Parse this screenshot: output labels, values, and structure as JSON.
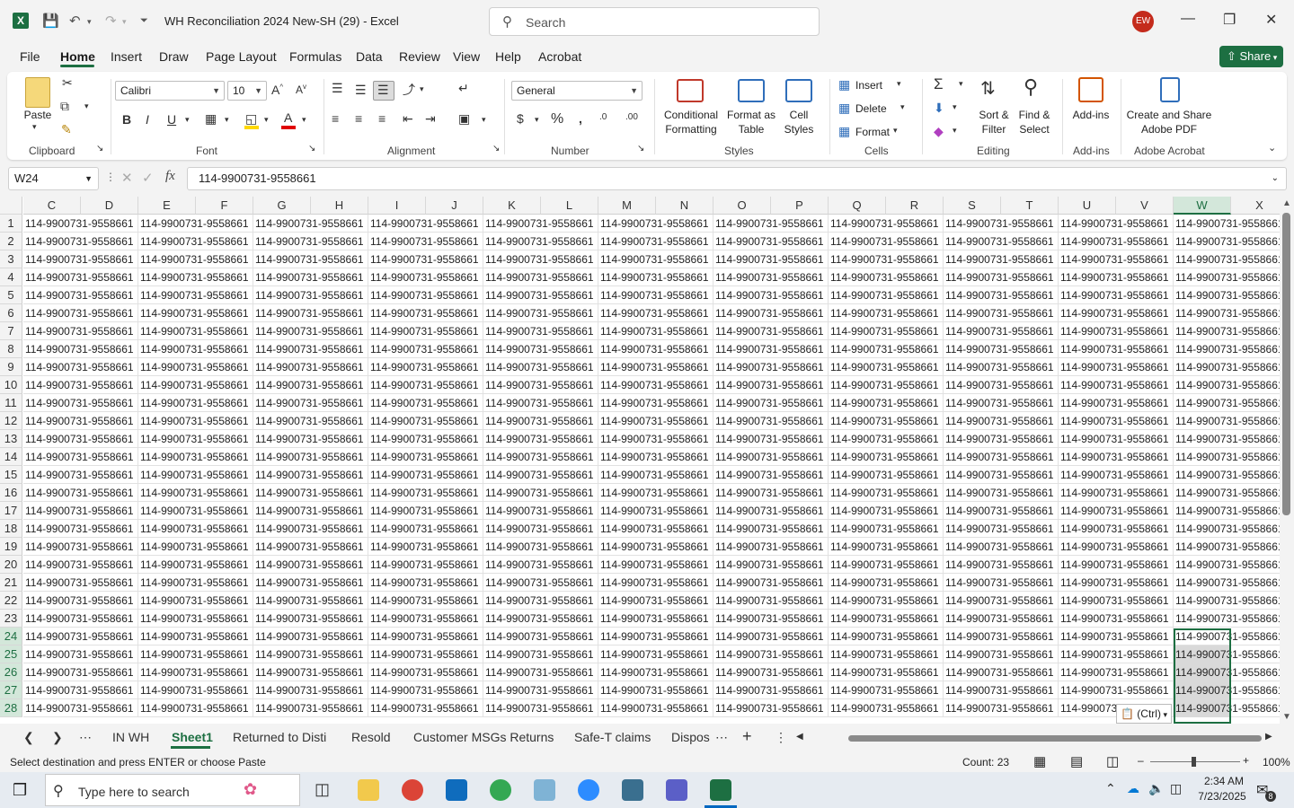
{
  "titlebar": {
    "app_icon": "excel-icon",
    "doc_title": "WH Reconciliation 2024 New-SH (29)  -  Excel",
    "search_placeholder": "Search",
    "avatar_initials": "EW"
  },
  "menu": {
    "items": [
      "File",
      "Home",
      "Insert",
      "Draw",
      "Page Layout",
      "Formulas",
      "Data",
      "Review",
      "View",
      "Help",
      "Acrobat"
    ],
    "active": "Home",
    "share_label": "Share"
  },
  "ribbon": {
    "clipboard": {
      "paste": "Paste",
      "label": "Clipboard"
    },
    "font": {
      "name": "Calibri",
      "size": "10",
      "label": "Font"
    },
    "alignment": {
      "label": "Alignment"
    },
    "number": {
      "format": "General",
      "label": "Number"
    },
    "styles": {
      "conditional": "Conditional",
      "conditional2": "Formatting",
      "format_as": "Format as",
      "table": "Table",
      "cell": "Cell",
      "cell_styles": "Styles",
      "label": "Styles"
    },
    "cells": {
      "insert": "Insert",
      "delete": "Delete",
      "format": "Format",
      "label": "Cells"
    },
    "editing": {
      "sort": "Sort &",
      "filter": "Filter",
      "find": "Find &",
      "select": "Select",
      "label": "Editing"
    },
    "addins": {
      "addins": "Add-ins",
      "label": "Add-ins"
    },
    "acrobat": {
      "create": "Create and Share",
      "pdf": "Adobe PDF",
      "label": "Adobe Acrobat"
    }
  },
  "formula_bar": {
    "name_box": "W24",
    "fx": "fx",
    "formula": "114-9900731-9558661"
  },
  "grid": {
    "columns": [
      "C",
      "D",
      "E",
      "F",
      "G",
      "H",
      "I",
      "J",
      "K",
      "L",
      "M",
      "N",
      "O",
      "P",
      "Q",
      "R",
      "S",
      "T",
      "U",
      "V",
      "W",
      "X"
    ],
    "selected_column": "W",
    "rows": [
      "1",
      "2",
      "3",
      "4",
      "5",
      "6",
      "7",
      "8",
      "9",
      "10",
      "11",
      "12",
      "13",
      "14",
      "15",
      "16",
      "17",
      "18",
      "19",
      "20",
      "21",
      "22",
      "23",
      "24",
      "25",
      "26",
      "27",
      "28"
    ],
    "selected_rows": [
      "24",
      "25",
      "26",
      "27",
      "28"
    ],
    "cell_value": "114-9900731-9558661",
    "paste_options_label": "(Ctrl)"
  },
  "sheets": {
    "tabs": [
      "IN WH",
      "Sheet1",
      "Returned to Disti",
      "Resold",
      "Customer MSGs Returns",
      "Safe-T claims",
      "Dispos"
    ],
    "active": "Sheet1"
  },
  "status": {
    "message": "Select destination and press ENTER or choose Paste",
    "count": "Count: 23",
    "zoom": "100%"
  },
  "taskbar": {
    "search_placeholder": "Type here to search",
    "time": "2:34 AM",
    "date": "7/23/2025",
    "notif_count": "8"
  }
}
